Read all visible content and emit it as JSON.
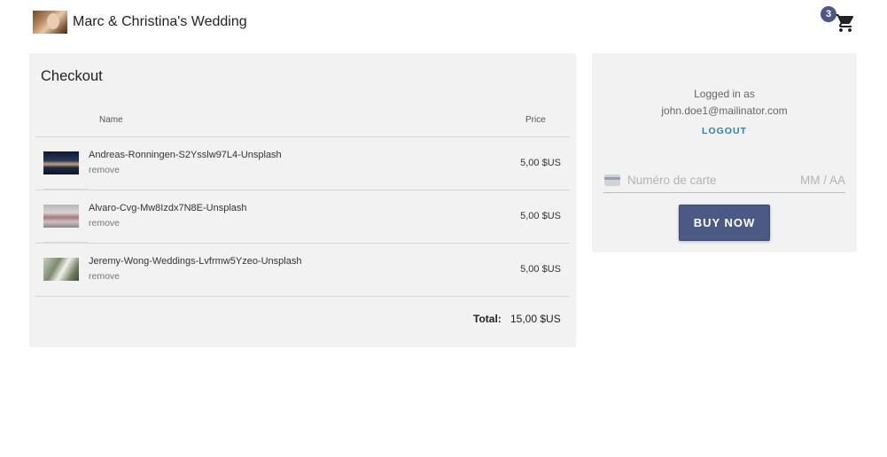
{
  "header": {
    "site_title": "Marc & Christina's Wedding",
    "cart_count": "3",
    "cart_icon": "cart-icon"
  },
  "checkout": {
    "title": "Checkout",
    "columns": {
      "name": "Name",
      "price": "Price"
    },
    "items": [
      {
        "name": "Andreas-Ronningen-S2Ysslw97L4-Unsplash",
        "remove": "remove",
        "price": "5,00 $US"
      },
      {
        "name": "Alvaro-Cvg-Mw8Izdx7N8E-Unsplash",
        "remove": "remove",
        "price": "5,00 $US"
      },
      {
        "name": "Jeremy-Wong-Weddings-Lvfrmw5Yzeo-Unsplash",
        "remove": "remove",
        "price": "5,00 $US"
      }
    ],
    "total_label": "Total:",
    "total_value": "15,00 $US"
  },
  "account": {
    "logged_in_as": "Logged in as",
    "email": "john.doe1@mailinator.com",
    "logout_label": "LOGOUT",
    "card_placeholder": "Numéro de carte",
    "expiry_placeholder": "MM / AA",
    "buy_label": "BUY NOW"
  },
  "colors": {
    "accent": "#4a5a85",
    "link": "#2f7fb8",
    "panel_bg": "#f2f2f2"
  }
}
